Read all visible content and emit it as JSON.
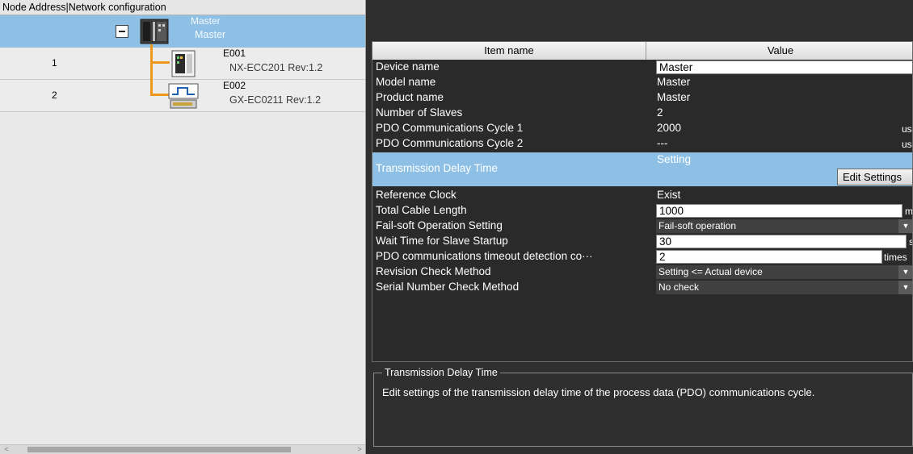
{
  "left_pane": {
    "header": "Node Address|Network configuration",
    "nodes": [
      {
        "address": "",
        "name": "Master",
        "model": "Master",
        "icon": "master-unit-icon",
        "selected": true
      },
      {
        "address": "1",
        "name": "E001",
        "model": "NX-ECC201 Rev:1.2",
        "icon": "coupler-unit-icon"
      },
      {
        "address": "2",
        "name": "E002",
        "model": "GX-EC0211 Rev:1.2",
        "icon": "io-terminal-icon"
      }
    ],
    "scroll_left_glyph": "<",
    "scroll_right_glyph": ">"
  },
  "property_table": {
    "headers": {
      "item": "Item name",
      "value": "Value"
    },
    "rows": [
      {
        "name": "Device name",
        "value": "Master",
        "kind": "text-input"
      },
      {
        "name": "Model name",
        "value": "Master"
      },
      {
        "name": "Product name",
        "value": "Master"
      },
      {
        "name": "Number of Slaves",
        "value": "2"
      },
      {
        "name": "PDO Communications Cycle 1",
        "value": "2000",
        "unit": "us"
      },
      {
        "name": "PDO Communications Cycle 2",
        "value": "---",
        "unit": "us"
      },
      {
        "name": "Transmission Delay Time",
        "value": "Setting",
        "button": "Edit Settings",
        "selected": true
      },
      {
        "name": "Reference Clock",
        "value": "Exist"
      },
      {
        "name": "Total Cable Length",
        "value": "1000",
        "unit": "m",
        "kind": "text-input"
      },
      {
        "name": "Fail-soft Operation Setting",
        "value": "Fail-soft operation",
        "kind": "select"
      },
      {
        "name": "Wait Time for Slave Startup",
        "value": "30",
        "unit": "s",
        "kind": "text-input"
      },
      {
        "name": "PDO communications timeout detection co···",
        "value": "2",
        "unit": "times",
        "kind": "text-input"
      },
      {
        "name": "Revision Check Method",
        "value": "Setting <= Actual device",
        "kind": "select"
      },
      {
        "name": "Serial Number Check Method",
        "value": "No check",
        "kind": "select"
      }
    ],
    "dropdown_glyph": "▼"
  },
  "description": {
    "title": "Transmission Delay Time",
    "text": "Edit settings of the transmission delay time of the process data (PDO) communications cycle."
  },
  "colors": {
    "selection": "#8ec0e6",
    "connection_line": "#f0981c",
    "panel_dark": "#2f2f2f"
  }
}
